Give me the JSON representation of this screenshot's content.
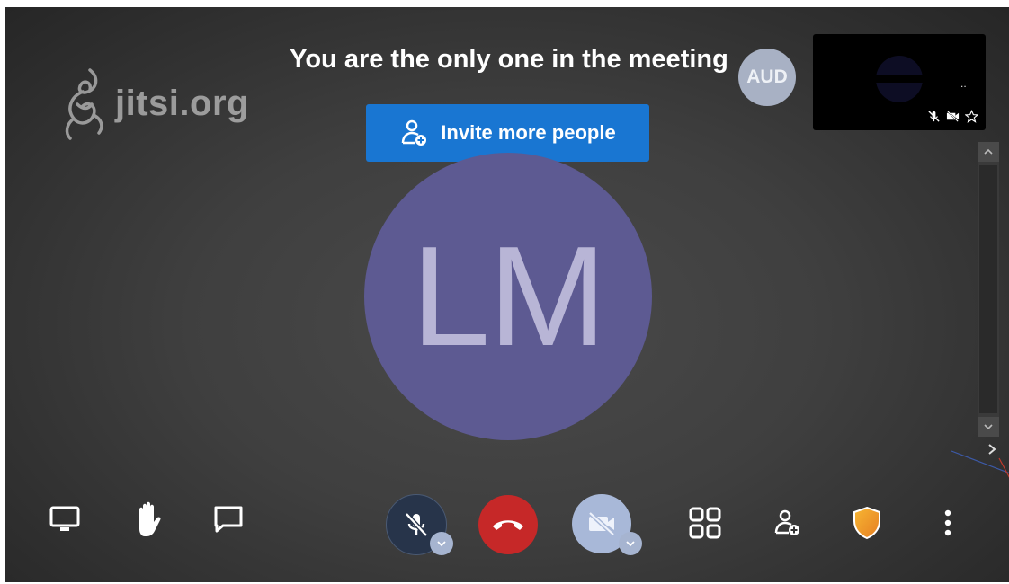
{
  "branding": {
    "logo_text": "jitsi.org",
    "logo_icon": "jitsi-logo-icon"
  },
  "prejoin_notice": {
    "title": "You are the only one in the meeting",
    "invite_button_label": "Invite more people",
    "invite_icon": "add-person-icon"
  },
  "local_participant": {
    "initials": "LM",
    "avatar_color": "#5d5a92"
  },
  "dominant_speaker_avatar": {
    "initials": "AUD",
    "color": "#a8b1c4"
  },
  "filmstrip": {
    "thumbnail_dots": "..",
    "thumbnail_icons": [
      "mic-muted-icon",
      "camera-off-icon",
      "star-icon"
    ]
  },
  "toolbar": {
    "left": [
      "screen-share-icon",
      "raise-hand-icon",
      "chat-icon"
    ],
    "center": [
      "microphone-muted-icon",
      "hangup-icon",
      "camera-off-icon"
    ],
    "right": [
      "tile-view-icon",
      "invite-person-icon",
      "security-shield-icon",
      "more-options-icon"
    ]
  },
  "colors": {
    "accent_blue": "#1976d2",
    "hangup_red": "#c62828",
    "shield_orange": "#f39c12"
  }
}
